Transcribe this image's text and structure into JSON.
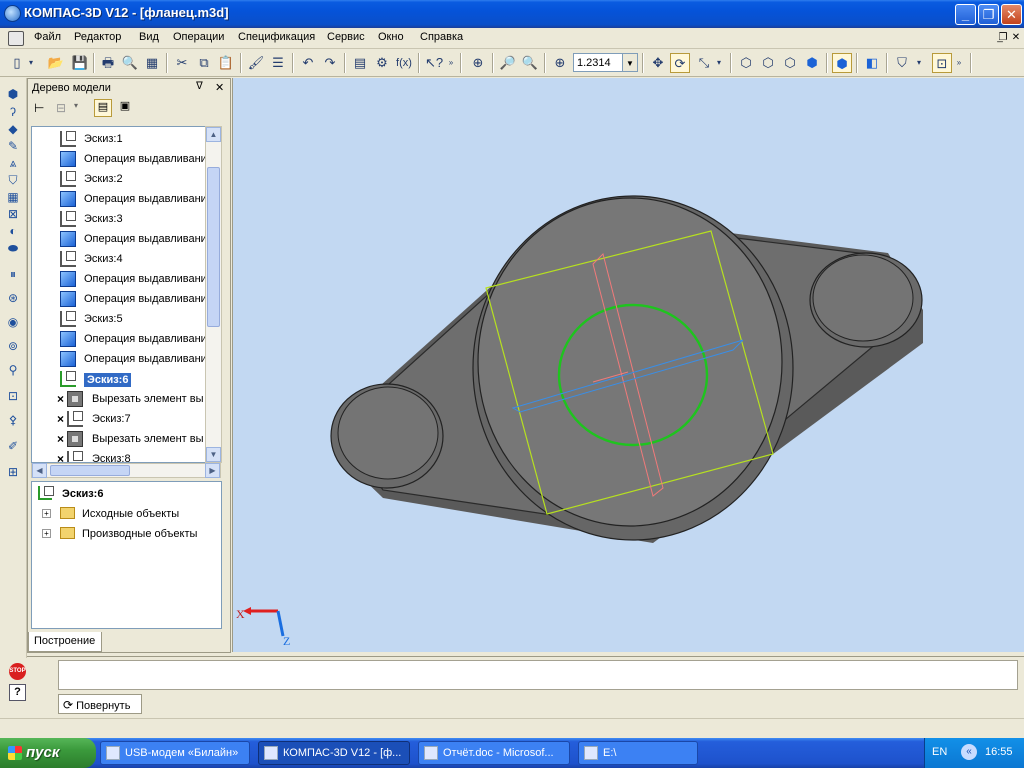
{
  "window": {
    "title": "КОМПАС-3D V12 - [фланец.m3d]",
    "controls": {
      "minimize": "_",
      "maximize": "❐",
      "close": "✕"
    }
  },
  "menu": {
    "items": [
      {
        "label": "Файл",
        "u": "Ф",
        "rest": "айл"
      },
      {
        "label": "Редактор",
        "u": "Р",
        "rest": "едактор"
      },
      {
        "label": "Вид",
        "u": "В",
        "rest": "ид"
      },
      {
        "label": "Операции",
        "u": "О",
        "rest": "перации"
      },
      {
        "label": "Спецификация",
        "u": "С",
        "rest": "пецификация"
      },
      {
        "label": "Сервис",
        "u": "С",
        "rest": "ервис"
      },
      {
        "label": "Окно",
        "u": "О",
        "rest": "кно"
      },
      {
        "label": "Справка",
        "u": "С",
        "rest": "правка"
      }
    ],
    "mdi": {
      "minimize": "_",
      "restore": "❐",
      "close": "✕"
    }
  },
  "toolbar": {
    "zoom_value": "1.2314",
    "fx_label": "f(x)"
  },
  "tree": {
    "title": "Дерево модели",
    "pin": "ᐁ",
    "close": "✕",
    "items": [
      {
        "label": "Эскиз:1",
        "type": "sketch",
        "x": false,
        "selected": false
      },
      {
        "label": "Операция выдавливани",
        "type": "op",
        "x": false,
        "selected": false
      },
      {
        "label": "Эскиз:2",
        "type": "sketch",
        "x": false,
        "selected": false
      },
      {
        "label": "Операция выдавливани",
        "type": "op",
        "x": false,
        "selected": false
      },
      {
        "label": "Эскиз:3",
        "type": "sketch",
        "x": false,
        "selected": false
      },
      {
        "label": "Операция выдавливани",
        "type": "op",
        "x": false,
        "selected": false
      },
      {
        "label": "Эскиз:4",
        "type": "sketch",
        "x": false,
        "selected": false
      },
      {
        "label": "Операция выдавливани",
        "type": "op",
        "x": false,
        "selected": false
      },
      {
        "label": "Операция выдавливани",
        "type": "op",
        "x": false,
        "selected": false
      },
      {
        "label": "Эскиз:5",
        "type": "sketch",
        "x": false,
        "selected": false
      },
      {
        "label": "Операция выдавливани",
        "type": "op",
        "x": false,
        "selected": false
      },
      {
        "label": "Операция выдавливани",
        "type": "op",
        "x": false,
        "selected": false
      },
      {
        "label": "Эскиз:6",
        "type": "sketch",
        "x": false,
        "selected": true
      },
      {
        "label": "Вырезать элемент вы",
        "type": "cut",
        "x": true,
        "selected": false
      },
      {
        "label": "Эскиз:7",
        "type": "sketch",
        "x": true,
        "selected": false
      },
      {
        "label": "Вырезать элемент вы",
        "type": "cut",
        "x": true,
        "selected": false
      },
      {
        "label": "Эскиз:8",
        "type": "sketch",
        "x": true,
        "selected": false
      }
    ],
    "lower": {
      "selected_label": "Эскиз:6",
      "folders": [
        "Исходные объекты",
        "Производные объекты"
      ]
    },
    "tab_label": "Построение"
  },
  "viewport": {
    "axis_x": "X",
    "axis_z": "Z"
  },
  "command": {
    "stop_label": "STOP",
    "help_label": "?",
    "rotate_tab": "Повернуть"
  },
  "taskbar": {
    "start": "пуск",
    "tasks": [
      {
        "label": "USB-модем «Билайн»",
        "active": false
      },
      {
        "label": "КОМПАС-3D V12 - [ф...",
        "active": true
      },
      {
        "label": "Отчёт.doc - Microsof...",
        "active": false
      },
      {
        "label": "E:\\",
        "active": false
      }
    ],
    "lang": "EN",
    "time": "16:55"
  }
}
